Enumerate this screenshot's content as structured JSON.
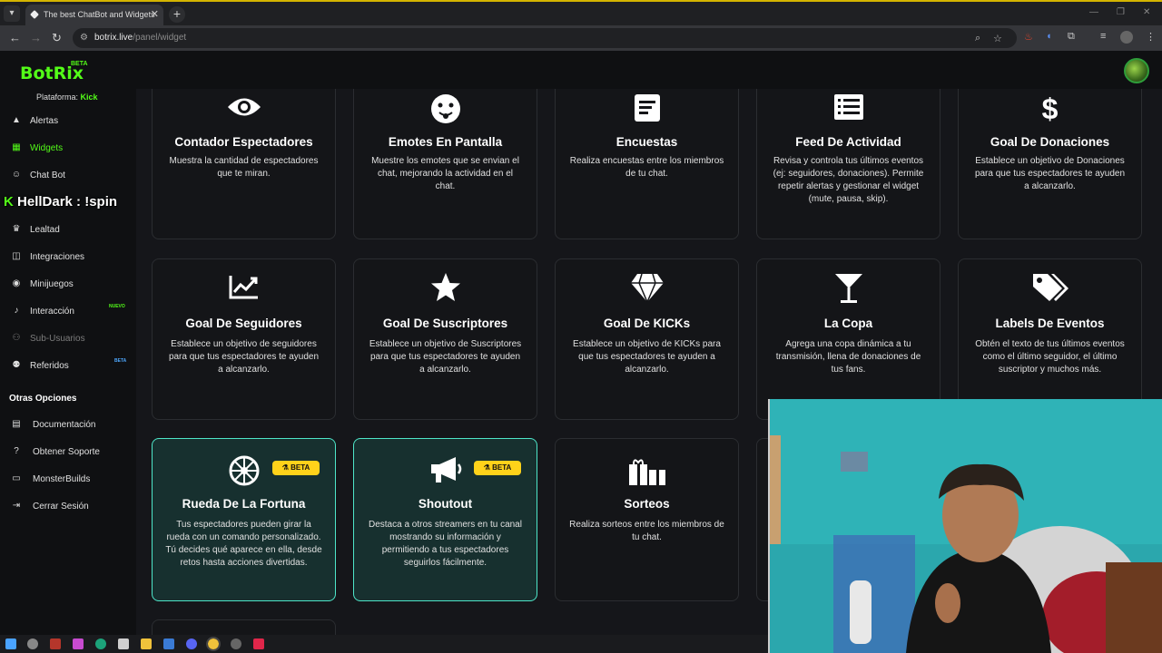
{
  "browser": {
    "tab_title": "The best ChatBot and Widgets",
    "url_host": "botrix.live",
    "url_path": "/panel/widget"
  },
  "app": {
    "logo": "BotRix",
    "logo_badge": "BETA"
  },
  "sidebar": {
    "platform_label": "Plataforma:",
    "platform_value": "Kick",
    "items": [
      {
        "label": "Alertas",
        "icon": "warning-icon"
      },
      {
        "label": "Widgets",
        "icon": "grid-icon",
        "active": true
      },
      {
        "label": "Chat Bot",
        "icon": "robot-icon"
      },
      {
        "label": "Lealtad",
        "icon": "trophy-icon"
      },
      {
        "label": "Integraciones",
        "icon": "plug-icon"
      },
      {
        "label": "Minijuegos",
        "icon": "gamepad-icon"
      },
      {
        "label": "Interacción",
        "icon": "music-icon",
        "badge": "NUEVO"
      },
      {
        "label": "Sub-Usuarios",
        "icon": "users-icon",
        "disabled": true
      },
      {
        "label": "Referidos",
        "icon": "people-icon",
        "badge": "BETA"
      }
    ],
    "other_title": "Otras Opciones",
    "other_items": [
      {
        "label": "Documentación",
        "icon": "book-icon"
      },
      {
        "label": "Obtener Soporte",
        "icon": "help-icon"
      },
      {
        "label": "MonsterBuilds",
        "icon": "laptop-icon"
      },
      {
        "label": "Cerrar Sesión",
        "icon": "logout-icon"
      }
    ]
  },
  "chat_overlay": {
    "user": "HellDark",
    "message": " : !spin"
  },
  "cards": [
    {
      "title": "Contador Espectadores",
      "desc": "Muestra la cantidad de espectadores que te miran.",
      "icon": "eye-icon"
    },
    {
      "title": "Emotes En Pantalla",
      "desc": "Muestre los emotes que se envian el chat, mejorando la actividad en el chat.",
      "icon": "emoji-icon"
    },
    {
      "title": "Encuestas",
      "desc": "Realiza encuestas entre los miembros de tu chat.",
      "icon": "poll-icon"
    },
    {
      "title": "Feed De Actividad",
      "desc": "Revisa y controla tus últimos eventos (ej: seguidores, donaciones). Permite repetir alertas y gestionar el widget (mute, pausa, skip).",
      "icon": "list-icon"
    },
    {
      "title": "Goal De Donaciones",
      "desc": "Establece un objetivo de Donaciones para que tus espectadores te ayuden a alcanzarlo.",
      "icon": "dollar-icon"
    },
    {
      "title": "Goal De Seguidores",
      "desc": "Establece un objetivo de seguidores para que tus espectadores te ayuden a alcanzarlo.",
      "icon": "chart-up-icon"
    },
    {
      "title": "Goal De Suscriptores",
      "desc": "Establece un objetivo de Suscriptores para que tus espectadores te ayuden a alcanzarlo.",
      "icon": "star-icon"
    },
    {
      "title": "Goal De KICKs",
      "desc": "Establece un objetivo de KICKs para que tus espectadores te ayuden a alcanzarlo.",
      "icon": "diamond-icon"
    },
    {
      "title": "La Copa",
      "desc": "Agrega una copa dinámica a tu transmisión, llena de donaciones de tus fans.",
      "icon": "cocktail-icon"
    },
    {
      "title": "Labels De Eventos",
      "desc": "Obtén el texto de tus últimos eventos como el último seguidor, el último suscriptor y muchos más.",
      "icon": "tags-icon"
    },
    {
      "title": "Rueda De La Fortuna",
      "desc": "Tus espectadores pueden girar la rueda con un comando personalizado. Tú decides qué aparece en ella, desde retos hasta acciones divertidas.",
      "icon": "wheel-icon",
      "badge": "BETA"
    },
    {
      "title": "Shoutout",
      "desc": "Destaca a otros streamers en tu canal mostrando su información y permitiendo a tus espectadores seguirlos fácilmente.",
      "icon": "megaphone-icon",
      "badge": "BETA"
    },
    {
      "title": "Sorteos",
      "desc": "Realiza sorteos entre los miembros de tu chat.",
      "icon": "gifts-icon"
    }
  ],
  "colors": {
    "accent": "#53fc18",
    "beta_card_border": "#4ee6c9",
    "beta_badge": "#ffd21a"
  }
}
